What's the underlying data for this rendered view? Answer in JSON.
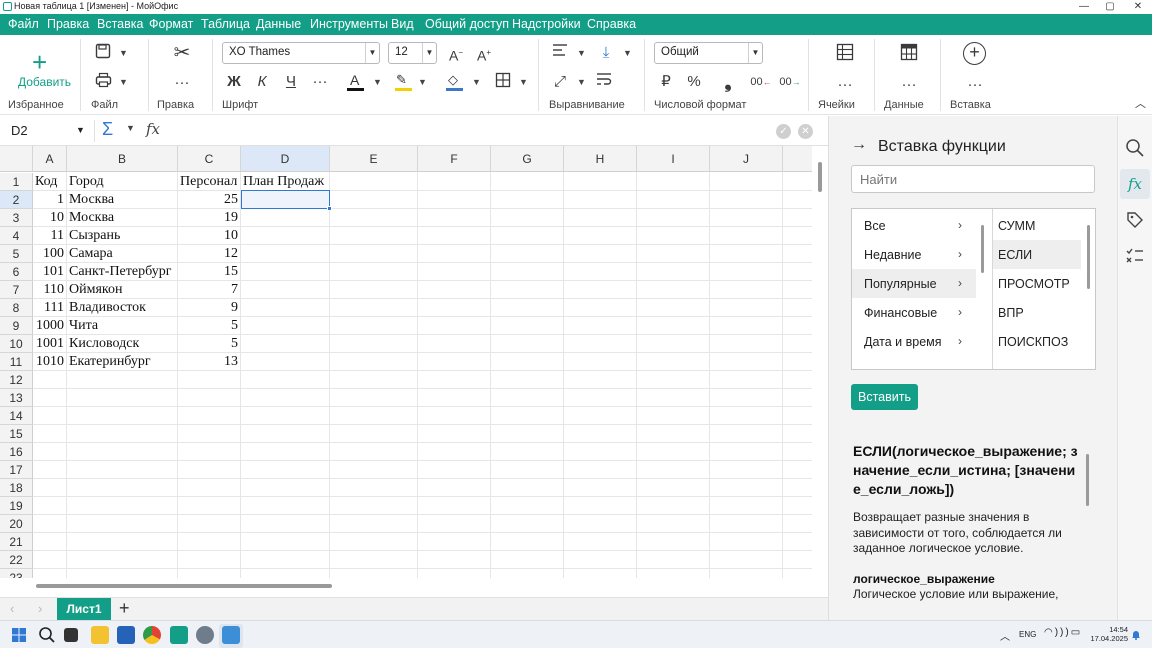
{
  "window": {
    "title": "Новая таблица 1 [Изменен] - МойОфис",
    "minimize": "—",
    "maximize": "▢",
    "close": "✕"
  },
  "menu": [
    "Файл",
    "Правка",
    "Вставка",
    "Формат",
    "Таблица",
    "Данные",
    "Инструменты",
    "Вид",
    "Общий доступ",
    "Надстройки",
    "Справка"
  ],
  "ribbon": {
    "add_label": "Добавить",
    "groups": {
      "favorites": "Избранное",
      "file": "Файл",
      "edit": "Правка",
      "font": "Шрифт",
      "alignment": "Выравнивание",
      "number_format": "Числовой формат",
      "cells": "Ячейки",
      "data": "Данные",
      "insert": "Вставка"
    },
    "font_name": "XO Thames",
    "font_size": "12",
    "number_format_value": "Общий",
    "bold_glyph": "Ж",
    "italic_glyph": "К",
    "underline_glyph": "Ч",
    "currency_glyph": "₽",
    "percent_glyph": "%"
  },
  "formula_bar": {
    "cell_ref": "D2",
    "sigma": "Σ",
    "fx": "fx"
  },
  "grid": {
    "columns": [
      "A",
      "B",
      "C",
      "D",
      "E",
      "F",
      "G",
      "H",
      "I",
      "J"
    ],
    "rows": [
      "1",
      "2",
      "3",
      "4",
      "5",
      "6",
      "7",
      "8",
      "9",
      "10",
      "11",
      "12",
      "13",
      "14",
      "15",
      "16",
      "17",
      "18",
      "19",
      "20",
      "21",
      "22",
      "23"
    ],
    "headers": {
      "a": "Код",
      "b": "Город",
      "c": "Персонал",
      "d": "План Продаж"
    },
    "data": [
      {
        "code": "1",
        "city": "Москва",
        "staff": "25"
      },
      {
        "code": "10",
        "city": "Москва",
        "staff": "19"
      },
      {
        "code": "11",
        "city": "Сызрань",
        "staff": "10"
      },
      {
        "code": "100",
        "city": "Самара",
        "staff": "12"
      },
      {
        "code": "101",
        "city": "Санкт-Петербург",
        "staff": "15"
      },
      {
        "code": "110",
        "city": "Оймякон",
        "staff": "7"
      },
      {
        "code": "111",
        "city": "Владивосток",
        "staff": "9"
      },
      {
        "code": "1000",
        "city": "Чита",
        "staff": "5"
      },
      {
        "code": "1001",
        "city": "Кисловодск",
        "staff": "5"
      },
      {
        "code": "1010",
        "city": "Екатеринбург",
        "staff": "13"
      }
    ],
    "selected_cell": "D2"
  },
  "sheets": {
    "active": "Лист1",
    "add": "+"
  },
  "panel": {
    "title": "Вставка функции",
    "search_placeholder": "Найти",
    "categories": [
      "Все",
      "Недавние",
      "Популярные",
      "Финансовые",
      "Дата и время"
    ],
    "selected_category": "Популярные",
    "functions": [
      "СУММ",
      "ЕСЛИ",
      "ПРОСМОТР",
      "ВПР",
      "ПОИСКПОЗ"
    ],
    "selected_function": "ЕСЛИ",
    "insert_button": "Вставить",
    "signature": "ЕСЛИ(логическое_выражение; значение_если_истина; [значение_если_ложь])",
    "description": "Возвращает разные значения в зависимости от того, соблюдается ли заданное логическое условие.",
    "param_name": "логическое_выражение",
    "param_desc": "Логическое условие или выражение,"
  },
  "taskbar": {
    "lang": "ENG",
    "time": "14:54",
    "date": "17.04.2025"
  },
  "colors": {
    "accent": "#139f87",
    "selection": "#2f78d4"
  }
}
